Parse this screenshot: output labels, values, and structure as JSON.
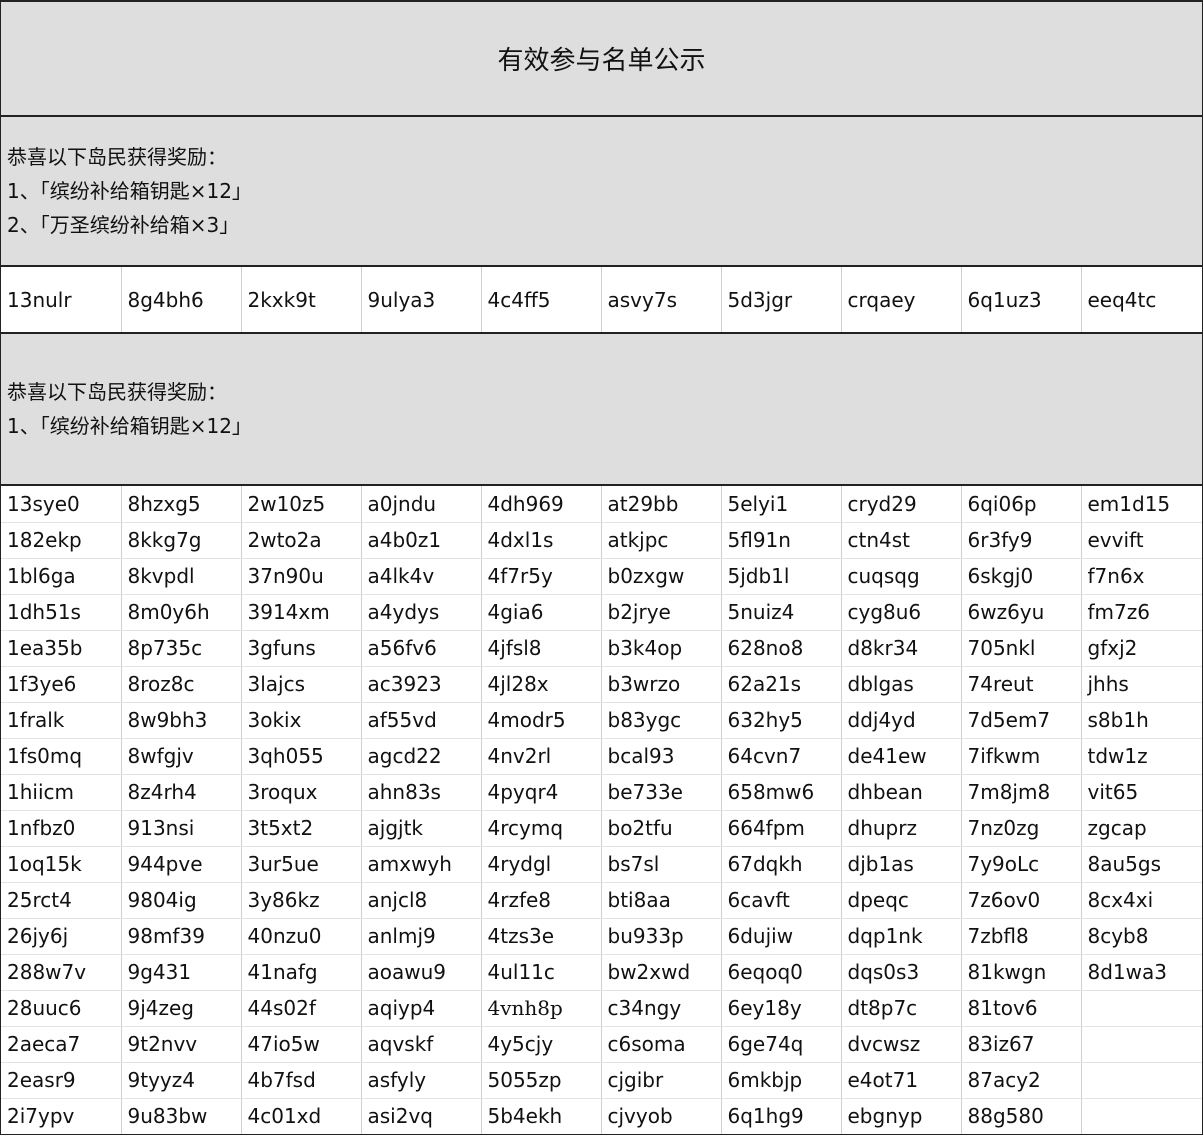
{
  "title": "有效参与名单公示",
  "section1": {
    "lines": [
      "恭喜以下岛民获得奖励：",
      "1、「缤纷补给箱钥匙×12」",
      "2、「万圣缤纷补给箱×3」"
    ],
    "names": [
      "13nulr",
      "8g4bh6",
      "2kxk9t",
      "9ulya3",
      "4c4ff5",
      "asvy7s",
      "5d3jgr",
      "crqaey",
      "6q1uz3",
      "eeq4tc"
    ]
  },
  "section2": {
    "lines": [
      "恭喜以下岛民获得奖励：",
      "1、「缤纷补给箱钥匙×12」"
    ],
    "rows": [
      [
        "13sye0",
        "8hzxg5",
        "2w10z5",
        "a0jndu",
        "4dh969",
        "at29bb",
        "5elyi1",
        "cryd29",
        "6qi06p",
        "em1d15"
      ],
      [
        "182ekp",
        "8kkg7g",
        "2wto2a",
        "a4b0z1",
        "4dxl1s",
        "atkjpc",
        "5fl91n",
        "ctn4st",
        "6r3fy9",
        "evvift"
      ],
      [
        "1bl6ga",
        "8kvpdl",
        "37n90u",
        "a4lk4v",
        "4f7r5y",
        "b0zxgw",
        "5jdb1l",
        "cuqsqg",
        "6skgj0",
        "f7n6x"
      ],
      [
        "1dh51s",
        "8m0y6h",
        "3914xm",
        "a4ydys",
        "4gia6",
        "b2jrye",
        "5nuiz4",
        "cyg8u6",
        "6wz6yu",
        "fm7z6"
      ],
      [
        "1ea35b",
        "8p735c",
        "3gfuns",
        "a56fv6",
        "4jfsl8",
        "b3k4op",
        "628no8",
        "d8kr34",
        "705nkl",
        "gfxj2"
      ],
      [
        "1f3ye6",
        "8roz8c",
        "3lajcs",
        "ac3923",
        "4jl28x",
        "b3wrzo",
        "62a21s",
        "dblgas",
        "74reut",
        "jhhs"
      ],
      [
        "1fralk",
        "8w9bh3",
        "3okix",
        "af55vd",
        "4modr5",
        "b83ygc",
        "632hy5",
        "ddj4yd",
        "7d5em7",
        "s8b1h"
      ],
      [
        "1fs0mq",
        "8wfgjv",
        "3qh055",
        "agcd22",
        "4nv2rl",
        "bcal93",
        "64cvn7",
        "de41ew",
        "7ifkwm",
        "tdw1z"
      ],
      [
        "1hiicm",
        "8z4rh4",
        "3roqux",
        "ahn83s",
        "4pyqr4",
        "be733e",
        "658mw6",
        "dhbean",
        "7m8jm8",
        "vit65"
      ],
      [
        "1nfbz0",
        "913nsi",
        "3t5xt2",
        "ajgjtk",
        "4rcymq",
        "bo2tfu",
        "664fpm",
        "dhuprz",
        "7nz0zg",
        "zgcap"
      ],
      [
        "1oq15k",
        "944pve",
        "3ur5ue",
        "amxwyh",
        "4rydgl",
        "bs7sl",
        "67dqkh",
        "djb1as",
        "7y9oLc",
        "8au5gs"
      ],
      [
        "25rct4",
        "9804ig",
        "3y86kz",
        "anjcl8",
        "4rzfe8",
        "bti8aa",
        "6cavft",
        "dpeqc",
        "7z6ov0",
        "8cx4xi"
      ],
      [
        "26jy6j",
        "98mf39",
        "40nzu0",
        "anlmj9",
        "4tzs3e",
        "bu933p",
        "6dujiw",
        "dqp1nk",
        "7zbfl8",
        "8cyb8"
      ],
      [
        "288w7v",
        "9g431",
        "41nafg",
        "aoawu9",
        "4ul11c",
        "bw2xwd",
        "6eqoq0",
        "dqs0s3",
        "81kwgn",
        "8d1wa3"
      ],
      [
        "28uuc6",
        "9j4zeg",
        "44s02f",
        "aqiyp4",
        "4vnh8p",
        "c34ngy",
        "6ey18y",
        "dt8p7c",
        "81tov6",
        ""
      ],
      [
        "2aeca7",
        "9t2nvv",
        "47io5w",
        "aqvskf",
        "4y5cjy",
        "c6soma",
        "6ge74q",
        "dvcwsz",
        "83iz67",
        ""
      ],
      [
        "2easr9",
        "9tyyz4",
        "4b7fsd",
        "asfyly",
        "5055zp",
        "cjgibr",
        "6mkbjp",
        "e4ot71",
        "87acy2",
        ""
      ],
      [
        "2i7ypv",
        "9u83bw",
        "4c01xd",
        "asi2vq",
        "5b4ekh",
        "cjvyob",
        "6q1hg9",
        "ebgnyp",
        "88g580",
        ""
      ]
    ]
  }
}
